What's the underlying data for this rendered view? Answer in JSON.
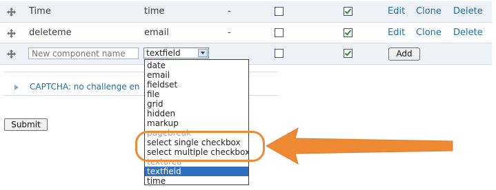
{
  "rows": [
    {
      "name": "Time",
      "type": "time",
      "value": "-",
      "mandatory": false,
      "email": true,
      "edit": "Edit",
      "clone": "Clone",
      "delete": "Delete"
    },
    {
      "name": "deleteme",
      "type": "email",
      "value": "-",
      "mandatory": false,
      "email": true,
      "edit": "Edit",
      "clone": "Clone",
      "delete": "Delete"
    }
  ],
  "new_row": {
    "name_placeholder": "New component name",
    "type_selected": "textfield",
    "mandatory": false,
    "email": true,
    "add_label": "Add"
  },
  "captcha": {
    "label": "CAPTCHA: no challenge en"
  },
  "submit_label": "Submit",
  "dropdown_options": [
    "date",
    "email",
    "fieldset",
    "file",
    "grid",
    "hidden",
    "markup",
    "pagebreak",
    "select single checkbox",
    "select multiple checkboxes",
    "textarea",
    "textfield",
    "time"
  ],
  "dropdown_selected_index": 11,
  "annotation": {
    "highlight_color": "#ee8a33",
    "arrow_color": "#ee8a33"
  },
  "colors": {
    "link": "#1a6fa8",
    "selected_option": "#2f6fc2",
    "row_alt": "#eef2f6"
  }
}
